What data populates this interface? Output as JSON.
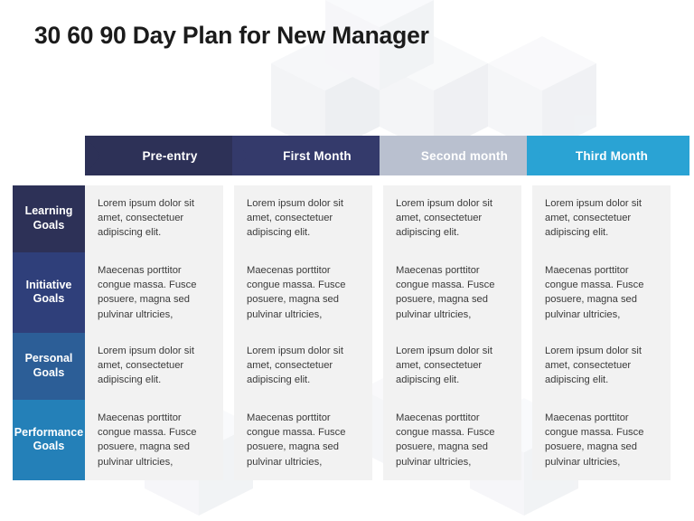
{
  "slide": {
    "title": "30 60 90 Day Plan for New Manager"
  },
  "phases": [
    {
      "label": "Pre-entry",
      "color": "#2d3157"
    },
    {
      "label": "First Month",
      "color": "#343a6b"
    },
    {
      "label": "Second month",
      "color": "#b9c0cf"
    },
    {
      "label": "Third Month",
      "color": "#2aa3d4"
    }
  ],
  "rows": [
    {
      "label": "Learning\nGoals",
      "label_line1": "Learning",
      "label_line2": "Goals",
      "color": "#2d3157",
      "cells": [
        "Lorem ipsum dolor sit amet, consectetuer adipiscing elit.",
        "Lorem ipsum dolor sit amet, consectetuer adipiscing elit.",
        "Lorem ipsum dolor sit amet, consectetuer adipiscing elit.",
        "Lorem ipsum dolor sit amet, consectetuer adipiscing elit."
      ]
    },
    {
      "label_line1": "Initiative",
      "label_line2": "Goals",
      "color": "#2f3f7a",
      "cells": [
        "Maecenas porttitor congue massa. Fusce posuere, magna sed pulvinar ultricies,",
        "Maecenas porttitor congue massa. Fusce posuere, magna sed pulvinar ultricies,",
        "Maecenas porttitor congue massa. Fusce posuere, magna sed pulvinar ultricies,",
        "Maecenas porttitor congue massa. Fusce posuere, magna sed pulvinar ultricies,"
      ]
    },
    {
      "label_line1": "Personal",
      "label_line2": "Goals",
      "color": "#2c5e97",
      "cells": [
        "Lorem ipsum dolor sit amet, consectetuer adipiscing elit.",
        "Lorem ipsum dolor sit amet, consectetuer adipiscing elit.",
        "Lorem ipsum dolor sit amet, consectetuer adipiscing elit.",
        "Lorem ipsum dolor sit amet, consectetuer adipiscing elit."
      ]
    },
    {
      "label_line1": "Performance",
      "label_line2": "Goals",
      "color": "#2480b8",
      "cells": [
        "Maecenas porttitor congue massa. Fusce posuere, magna sed pulvinar ultricies,",
        "Maecenas porttitor congue massa. Fusce posuere, magna sed pulvinar ultricies,",
        "Maecenas porttitor congue massa. Fusce posuere, magna sed pulvinar ultricies,",
        "Maecenas porttitor congue massa. Fusce posuere, magna sed pulvinar ultricies,"
      ]
    }
  ]
}
